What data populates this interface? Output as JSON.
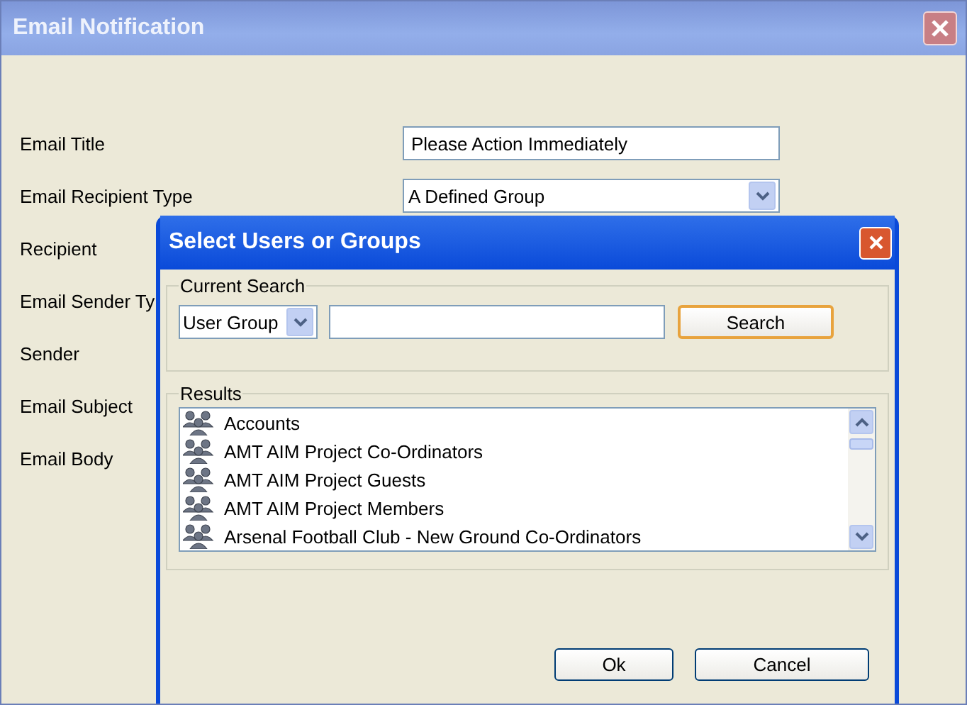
{
  "window": {
    "title": "Email Notification"
  },
  "form": {
    "rows": [
      {
        "label": "Email Title",
        "kind": "text",
        "value": "Please Action Immediately"
      },
      {
        "label": "Email Recipient Type",
        "kind": "select",
        "value": "A Defined Group"
      },
      {
        "label": "Recipient"
      },
      {
        "label": "Email Sender Ty"
      },
      {
        "label": "Sender"
      },
      {
        "label": "Email Subject"
      },
      {
        "label": "Email Body"
      }
    ]
  },
  "dialog": {
    "title": "Select Users or Groups",
    "search": {
      "legend": "Current Search",
      "type": "User Group",
      "button": "Search"
    },
    "results": {
      "legend": "Results",
      "items": [
        "Accounts",
        "AMT AIM Project Co-Ordinators",
        "AMT AIM Project Guests",
        "AMT AIM Project Members",
        "Arsenal Football Club - New Ground Co-Ordinators"
      ]
    },
    "buttons": [
      "Ok",
      "Cancel"
    ]
  }
}
